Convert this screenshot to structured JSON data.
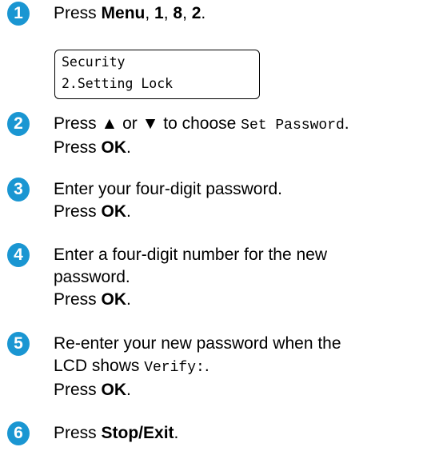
{
  "accent_color": "#1a96d2",
  "steps": [
    {
      "number": "1",
      "parts": [
        {
          "t": "Press "
        },
        {
          "t": "Menu",
          "b": true
        },
        {
          "t": ", "
        },
        {
          "t": "1",
          "b": true
        },
        {
          "t": ", "
        },
        {
          "t": "8",
          "b": true
        },
        {
          "t": ", "
        },
        {
          "t": "2",
          "b": true
        },
        {
          "t": "."
        }
      ]
    },
    {
      "number": "2",
      "parts": [
        {
          "t": "Press ▲ or ▼ to choose "
        },
        {
          "t": "Set Password",
          "m": true
        },
        {
          "t": "."
        },
        {
          "br": true
        },
        {
          "t": "Press "
        },
        {
          "t": "OK",
          "b": true
        },
        {
          "t": "."
        }
      ]
    },
    {
      "number": "3",
      "parts": [
        {
          "t": "Enter your four-digit password."
        },
        {
          "br": true
        },
        {
          "t": "Press "
        },
        {
          "t": "OK",
          "b": true
        },
        {
          "t": "."
        }
      ]
    },
    {
      "number": "4",
      "parts": [
        {
          "t": "Enter a four-digit number for the new"
        },
        {
          "br": true
        },
        {
          "t": "password."
        },
        {
          "br": true
        },
        {
          "t": "Press "
        },
        {
          "t": "OK",
          "b": true
        },
        {
          "t": "."
        }
      ]
    },
    {
      "number": "5",
      "parts": [
        {
          "t": "Re-enter your new password when the"
        },
        {
          "br": true
        },
        {
          "t": "LCD shows "
        },
        {
          "t": "Verify:",
          "m": true
        },
        {
          "t": "."
        },
        {
          "br": true
        },
        {
          "t": "Press "
        },
        {
          "t": "OK",
          "b": true
        },
        {
          "t": "."
        }
      ]
    },
    {
      "number": "6",
      "parts": [
        {
          "t": "Press "
        },
        {
          "t": "Stop/Exit",
          "b": true
        },
        {
          "t": "."
        }
      ]
    }
  ],
  "lcd": {
    "line1": "Security",
    "line2": "2.Setting Lock"
  }
}
